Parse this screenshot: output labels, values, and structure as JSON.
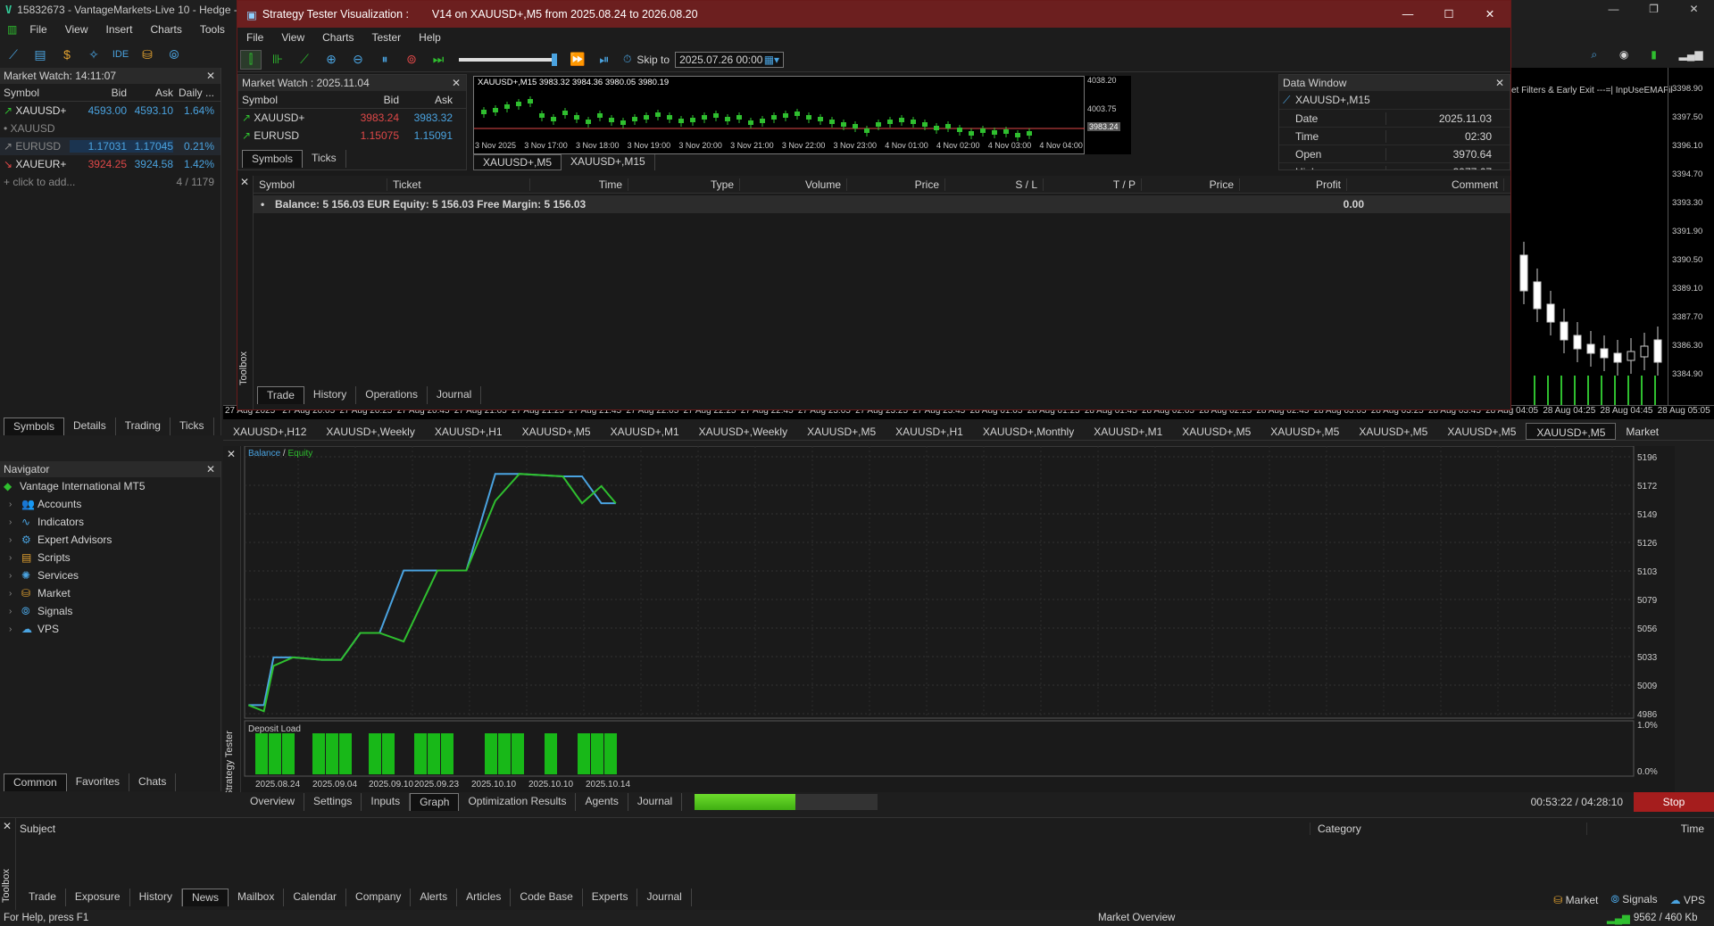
{
  "main": {
    "title": "15832673 - VantageMarkets-Live 10 - Hedge -",
    "menu": [
      "File",
      "View",
      "Insert",
      "Charts",
      "Tools"
    ]
  },
  "market_watch": {
    "header": "Market Watch: 14:11:07",
    "columns": [
      "Symbol",
      "Bid",
      "Ask",
      "Daily ..."
    ],
    "rows": [
      {
        "symbol": "XAUUSD+",
        "bid": "4593.00",
        "ask": "4593.10",
        "daily": "1.64%",
        "dir": "up"
      },
      {
        "symbol": "XAUUSD",
        "bid": "",
        "ask": "",
        "daily": "",
        "dir": "dot"
      },
      {
        "symbol": "EURUSD",
        "bid": "1.17031",
        "ask": "1.17045",
        "daily": "0.21%",
        "dir": "up"
      },
      {
        "symbol": "XAUEUR+",
        "bid": "3924.25",
        "ask": "3924.58",
        "daily": "1.42%",
        "dir": "down"
      }
    ],
    "add_text": "click to add...",
    "count": "4 / 1179",
    "tabs": [
      "Symbols",
      "Details",
      "Trading",
      "Ticks"
    ]
  },
  "navigator": {
    "header": "Navigator",
    "root": "Vantage International MT5",
    "items": [
      "Accounts",
      "Indicators",
      "Expert Advisors",
      "Scripts",
      "Services",
      "Market",
      "Signals",
      "VPS"
    ],
    "tabs": [
      "Common",
      "Favorites",
      "Chats"
    ]
  },
  "tester": {
    "title": "Strategy Tester Visualization :",
    "subtitle": "V14 on XAUUSD+,M5 from 2025.08.24 to 2026.08.20",
    "menu": [
      "File",
      "View",
      "Charts",
      "Tester",
      "Help"
    ],
    "skip_label": "Skip to",
    "skip_value": "2025.07.26 00:00",
    "inner_mw": {
      "header": "Market Watch : 2025.11.04",
      "columns": [
        "Symbol",
        "Bid",
        "Ask"
      ],
      "rows": [
        {
          "symbol": "XAUUSD+",
          "bid": "3983.24",
          "ask": "3983.32"
        },
        {
          "symbol": "EURUSD",
          "bid": "1.15075",
          "ask": "1.15091"
        }
      ],
      "tabs": [
        "Symbols",
        "Ticks"
      ]
    },
    "mini_chart": {
      "header": "XAUUSD+,M15  3983.32 3984.36 3980.05 3980.19",
      "prices": [
        "4038.20",
        "4003.75",
        "3983.24"
      ],
      "times": [
        "3 Nov 2025",
        "3 Nov 17:00",
        "3 Nov 18:00",
        "3 Nov 19:00",
        "3 Nov 20:00",
        "3 Nov 21:00",
        "3 Nov 22:00",
        "3 Nov 23:00",
        "4 Nov 01:00",
        "4 Nov 02:00",
        "4 Nov 03:00",
        "4 Nov 04:00"
      ],
      "tabs": [
        "XAUUSD+,M5",
        "XAUUSD+,M15"
      ]
    },
    "data_window": {
      "header": "Data Window",
      "symbol": "XAUUSD+,M15",
      "rows": [
        {
          "k": "Date",
          "v": "2025.11.03"
        },
        {
          "k": "Time",
          "v": "02:30"
        },
        {
          "k": "Open",
          "v": "3970.64"
        },
        {
          "k": "High",
          "v": "3977.67"
        }
      ]
    },
    "trade_table": {
      "columns": [
        "Symbol",
        "Ticket",
        "Time",
        "Type",
        "Volume",
        "Price",
        "S / L",
        "T / P",
        "Price",
        "Profit",
        "Comment"
      ],
      "balance_line": "Balance: 5 156.03 EUR  Equity: 5 156.03  Free Margin: 5 156.03",
      "profit": "0.00",
      "tabs": [
        "Trade",
        "History",
        "Operations",
        "Journal"
      ],
      "side_label": "Toolbox"
    }
  },
  "main_chart_axis": {
    "prices": [
      "3398.90",
      "3397.50",
      "3396.10",
      "3394.70",
      "3393.30",
      "3391.90",
      "3390.50",
      "3389.10",
      "3387.70",
      "3386.30",
      "3384.90"
    ],
    "times": [
      "27 Aug 2025",
      "27 Aug 20:05",
      "27 Aug 20:25",
      "27 Aug 20:45",
      "27 Aug 21:05",
      "27 Aug 21:25",
      "27 Aug 21:45",
      "27 Aug 22:05",
      "27 Aug 22:25",
      "27 Aug 22:45",
      "27 Aug 23:05",
      "27 Aug 23:25",
      "27 Aug 23:45",
      "28 Aug 01:05",
      "28 Aug 01:25",
      "28 Aug 01:45",
      "28 Aug 02:05",
      "28 Aug 02:25",
      "28 Aug 02:45",
      "28 Aug 03:05",
      "28 Aug 03:25",
      "28 Aug 03:45",
      "28 Aug 04:05",
      "28 Aug 04:25",
      "28 Aug 04:45",
      "28 Aug 05:05"
    ],
    "filters_text": "et Filters & Early Exit ---=| InpUseEMAFil"
  },
  "chart_tabs": [
    "XAUUSD+,H12",
    "XAUUSD+,Weekly",
    "XAUUSD+,H1",
    "XAUUSD+,M5",
    "XAUUSD+,M1",
    "XAUUSD+,Weekly",
    "XAUUSD+,M5",
    "XAUUSD+,H1",
    "XAUUSD+,Monthly",
    "XAUUSD+,M1",
    "XAUUSD+,M5",
    "XAUUSD+,M5",
    "XAUUSD+,M5",
    "XAUUSD+,M5",
    "XAUUSD+,M5",
    "Market"
  ],
  "chart_data": {
    "type": "line",
    "title": "",
    "series": [
      {
        "name": "Balance",
        "color": "#4aa3e0",
        "values": [
          4993,
          4993,
          5032,
          5032,
          5030,
          5030,
          5052,
          5052,
          5103,
          5103,
          5103,
          5182,
          5182,
          5180,
          5180,
          5158,
          5158
        ]
      },
      {
        "name": "Equity",
        "color": "#2fbf2f",
        "values": [
          4993,
          4988,
          5025,
          5032,
          5030,
          5030,
          5052,
          5052,
          5045,
          5103,
          5103,
          5160,
          5182,
          5180,
          5158,
          5172,
          5158
        ]
      }
    ],
    "y_ticks": [
      "5196",
      "5172",
      "5149",
      "5126",
      "5103",
      "5079",
      "5056",
      "5033",
      "5009",
      "4986"
    ],
    "ylim": [
      4986,
      5196
    ],
    "deposit_label": "Deposit Load",
    "deposit_ticks": [
      "1.0%",
      "0.0%"
    ],
    "deposit_bars": [
      1,
      1,
      1,
      1,
      1,
      1,
      1,
      1,
      1,
      1,
      1,
      1,
      1,
      1,
      1,
      1,
      1,
      1,
      1,
      1,
      1
    ],
    "x_dates": [
      "2025.08.24",
      "2025.09.04",
      "2025.09.10",
      "2025.09.23",
      "2025.10.10",
      "2025.10.10",
      "2025.10.14"
    ]
  },
  "tester_panel": {
    "tabs": [
      "Overview",
      "Settings",
      "Inputs",
      "Graph",
      "Optimization Results",
      "Agents",
      "Journal"
    ],
    "side_label": "Strategy Tester",
    "progress": 0.55,
    "time": "00:53:22 / 04:28:10",
    "stop": "Stop"
  },
  "toolbox": {
    "columns": [
      "Subject",
      "Category",
      "Time"
    ],
    "tabs": [
      "Trade",
      "Exposure",
      "History",
      "News",
      "Mailbox",
      "Calendar",
      "Company",
      "Alerts",
      "Articles",
      "Code Base",
      "Experts",
      "Journal"
    ],
    "side_label": "Toolbox",
    "right": [
      "Market",
      "Signals",
      "VPS"
    ]
  },
  "status": {
    "help": "For Help, press F1",
    "overview": "Market Overview",
    "traffic": "9562 / 460 Kb"
  },
  "colors": {
    "up": "#2fbf2f",
    "down": "#e04848",
    "balance": "#4aa3e0",
    "equity": "#2fbf2f",
    "title_bar": "#6c1f1f"
  }
}
